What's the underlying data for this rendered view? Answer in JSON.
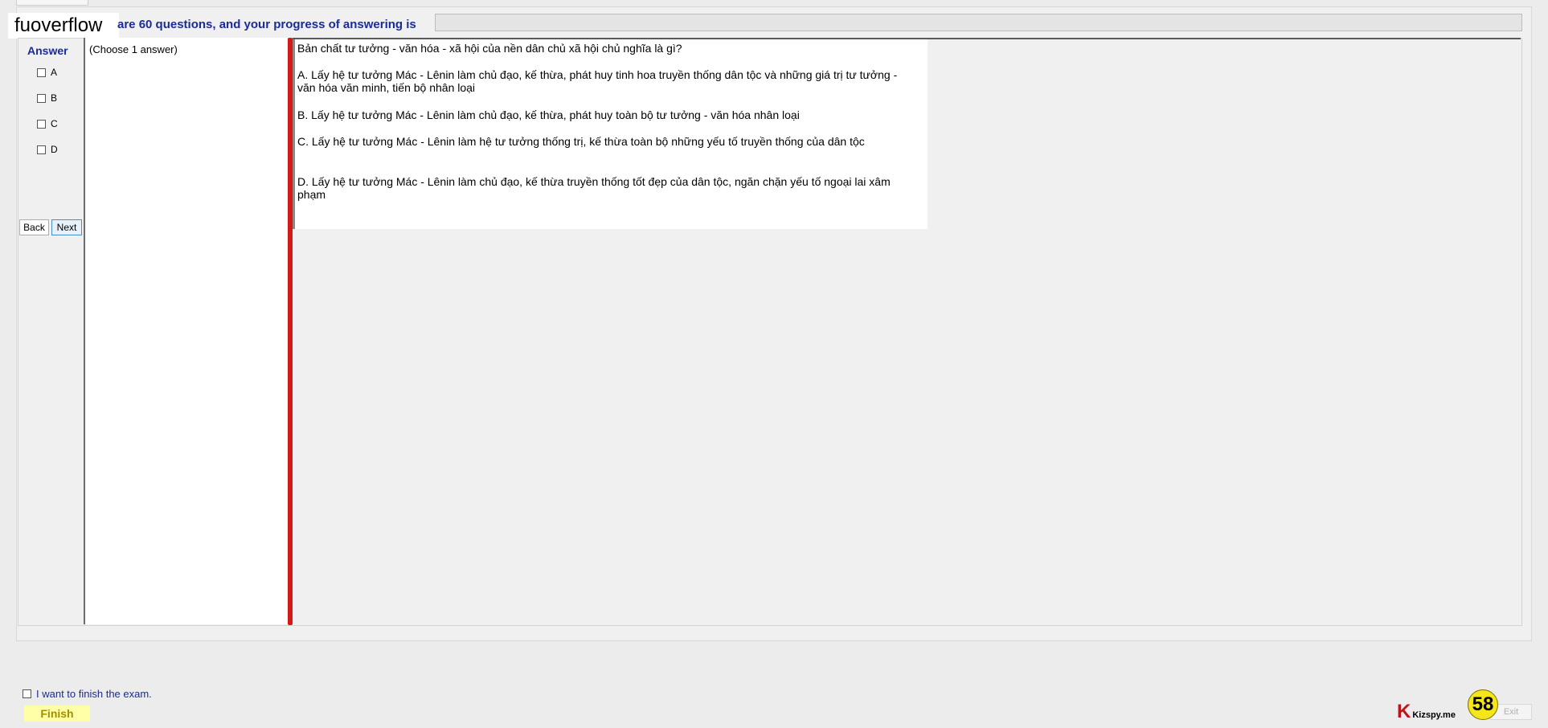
{
  "header": {
    "watermark": "fuoverflow",
    "progress_text": "are 60 questions, and your progress of answering is"
  },
  "answer_panel": {
    "title": "Answer",
    "options": [
      "A",
      "B",
      "C",
      "D"
    ],
    "back_label": "Back",
    "next_label": "Next"
  },
  "choose_hint": "(Choose 1 answer)",
  "question": {
    "text": "Bản chất tư tưởng - văn hóa - xã hội của nền dân chủ xã hội chủ nghĩa là gì?",
    "options": [
      "A.  Lấy hệ tư tưởng Mác - Lênin làm chủ đạo, kế thừa, phát huy tinh hoa truyền thống dân tộc và những giá trị tư tưởng - văn hóa văn minh, tiến bộ nhân loại",
      "B.  Lấy hệ tư tưởng Mác - Lênin làm chủ đạo, kế thừa, phát huy toàn bộ tư tưởng - văn hóa nhân loại",
      "C.  Lấy hệ tư tưởng Mác - Lênin làm hệ tư tưởng thống trị, kế thừa toàn bộ những yếu tố truyền thống của dân tộc",
      "D.  Lấy hệ tư tưởng Mác - Lênin làm chủ đạo, kế thừa truyền thống tốt đẹp của dân tộc, ngăn chặn yếu tố ngoại lai xâm phạm"
    ]
  },
  "footer": {
    "finish_checkbox_label": "I want to finish the exam.",
    "finish_label": "Finish",
    "brand_mark": "K",
    "brand_text": "Kizspy.me",
    "counter": "58",
    "exit_label": "Exit"
  },
  "colors": {
    "accent_blue": "#1a2b9a",
    "separator_red": "#d41919",
    "finish_yellow": "#ffffa8",
    "counter_yellow": "#f5e61c"
  }
}
